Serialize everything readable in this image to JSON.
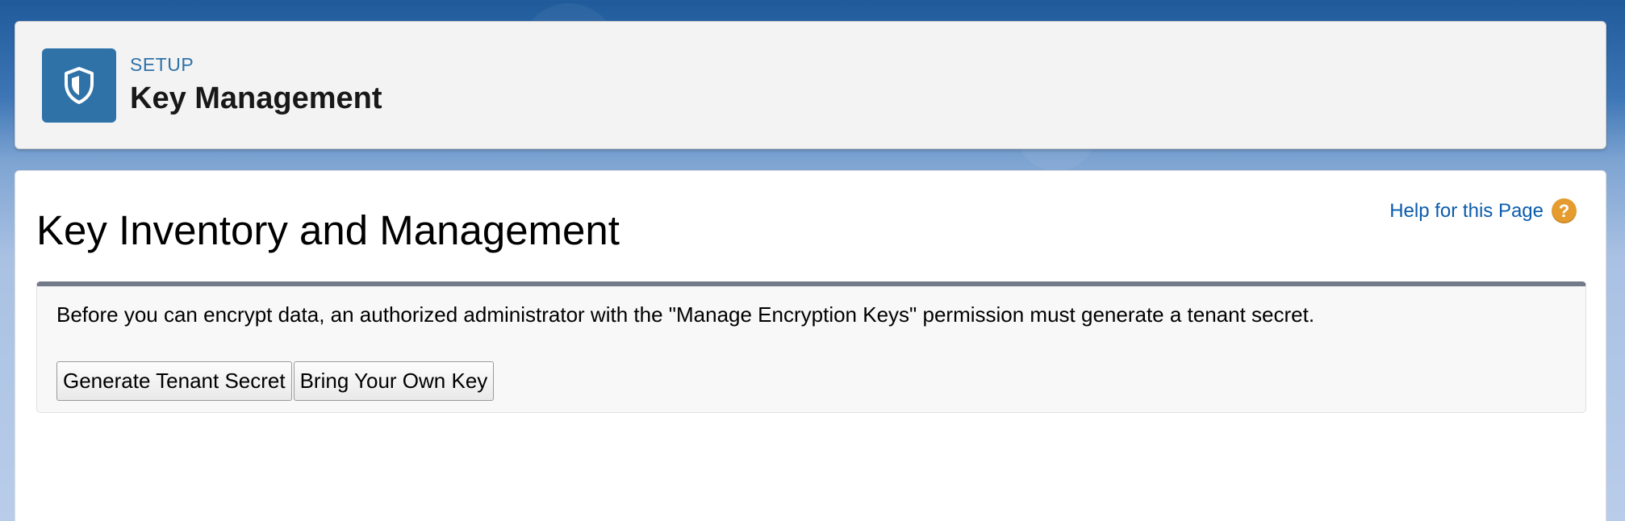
{
  "header": {
    "eyebrow": "SETUP",
    "title": "Key Management",
    "icon": "shield-icon",
    "icon_color": "#2f72a8"
  },
  "main": {
    "title": "Key Inventory and Management",
    "help_link": "Help for this Page",
    "help_icon_glyph": "?",
    "help_icon_color": "#e59c2f",
    "info_text": "Before you can encrypt data, an authorized administrator with the \"Manage Encryption Keys\" permission must generate a tenant secret.",
    "buttons": [
      {
        "label": "Generate Tenant Secret"
      },
      {
        "label": "Bring Your Own Key"
      }
    ]
  }
}
